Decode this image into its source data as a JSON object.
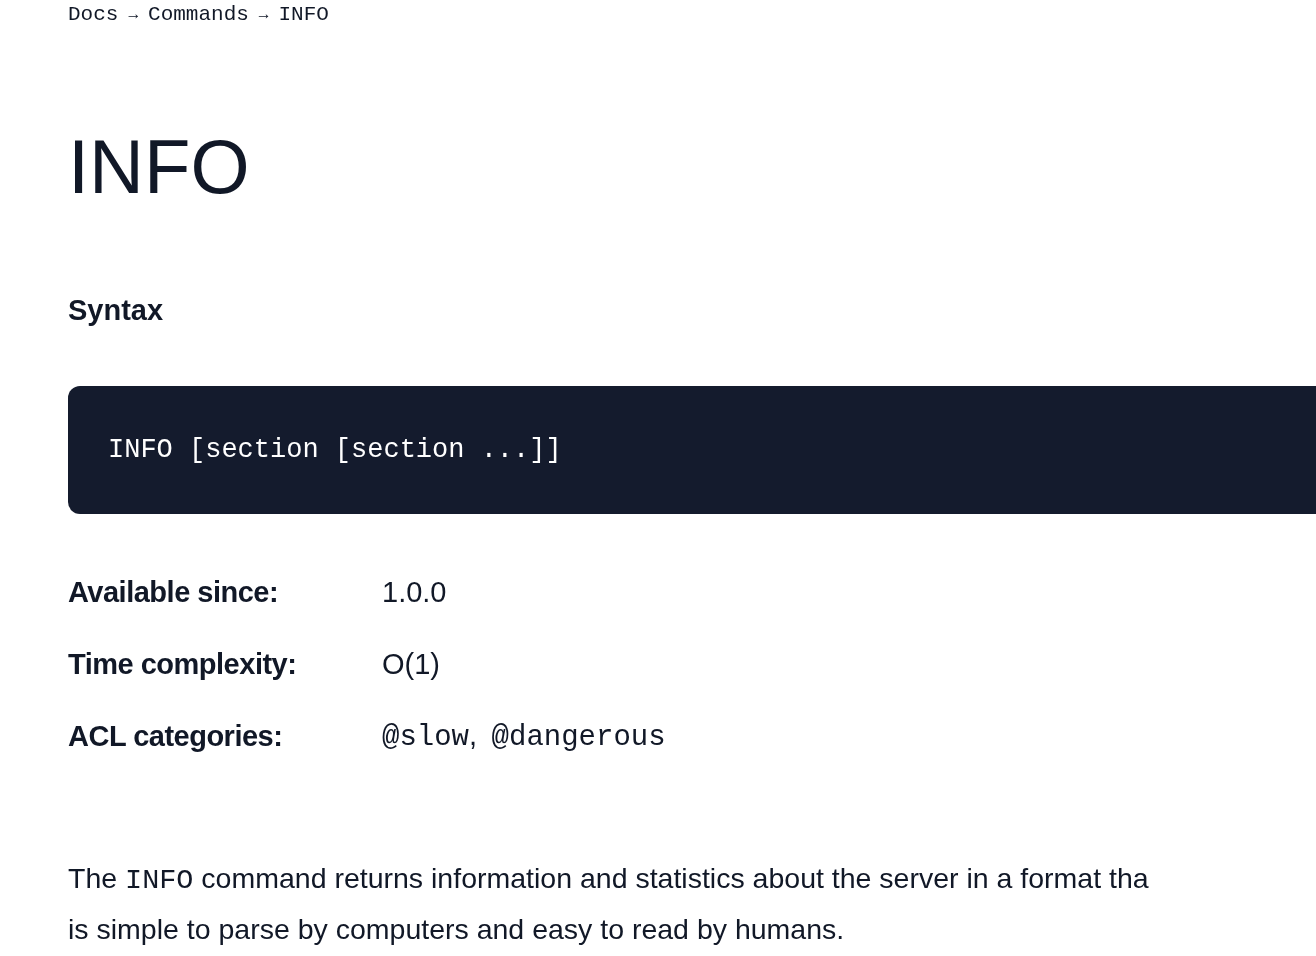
{
  "breadcrumb": [
    "Docs",
    "Commands",
    "INFO"
  ],
  "breadcrumb_separator": "→",
  "title": "INFO",
  "syntax": {
    "heading": "Syntax",
    "code": "INFO [section [section ...]]"
  },
  "metadata": [
    {
      "label": "Available since:",
      "kind": "text",
      "value": "1.0.0"
    },
    {
      "label": "Time complexity:",
      "kind": "text",
      "value": "O(1)"
    },
    {
      "label": "ACL categories:",
      "kind": "tags",
      "values": [
        "@slow",
        "@dangerous"
      ],
      "separator": ","
    }
  ],
  "description": {
    "lines": [
      [
        {
          "kind": "text",
          "text": "The "
        },
        {
          "kind": "code",
          "text": "INFO"
        },
        {
          "kind": "text",
          "text": " command returns information and statistics about the server in a format tha"
        }
      ],
      [
        {
          "kind": "text",
          "text": "is simple to parse by computers and easy to read by humans."
        }
      ]
    ]
  }
}
